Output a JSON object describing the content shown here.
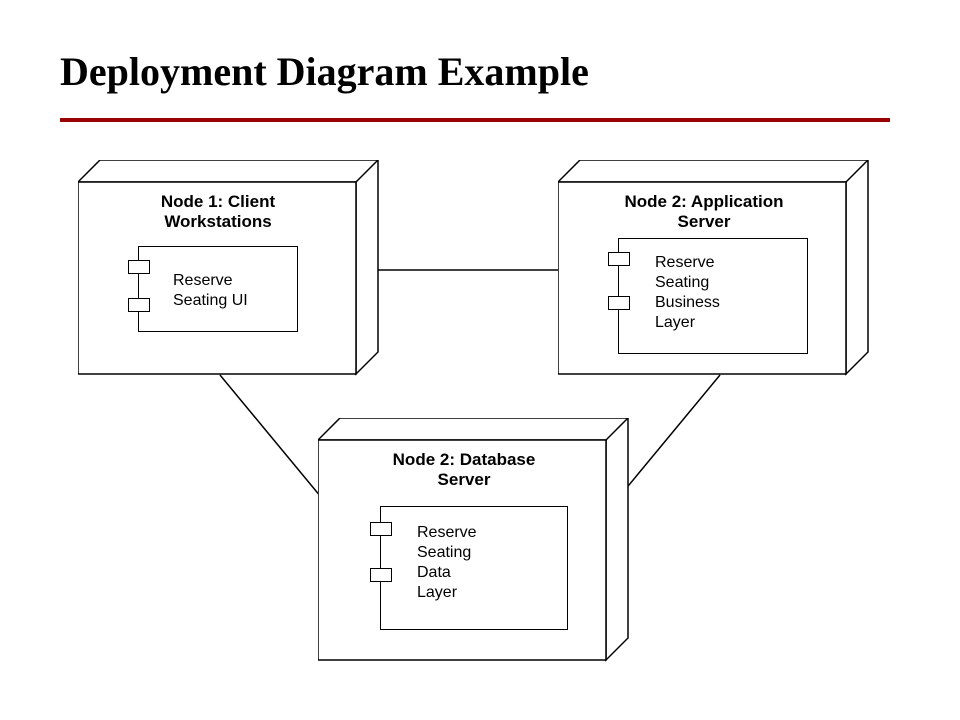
{
  "title": "Deployment Diagram Example",
  "nodes": {
    "client": {
      "title_line1": "Node 1:  Client",
      "title_line2": "Workstations",
      "component": "Reserve\nSeating UI"
    },
    "app": {
      "title_line1": "Node 2:  Application",
      "title_line2": "Server",
      "component": "Reserve\nSeating\nBusiness\nLayer"
    },
    "db": {
      "title_line1": "Node 2:  Database",
      "title_line2": "Server",
      "component": "Reserve\nSeating\nData\nLayer"
    }
  }
}
